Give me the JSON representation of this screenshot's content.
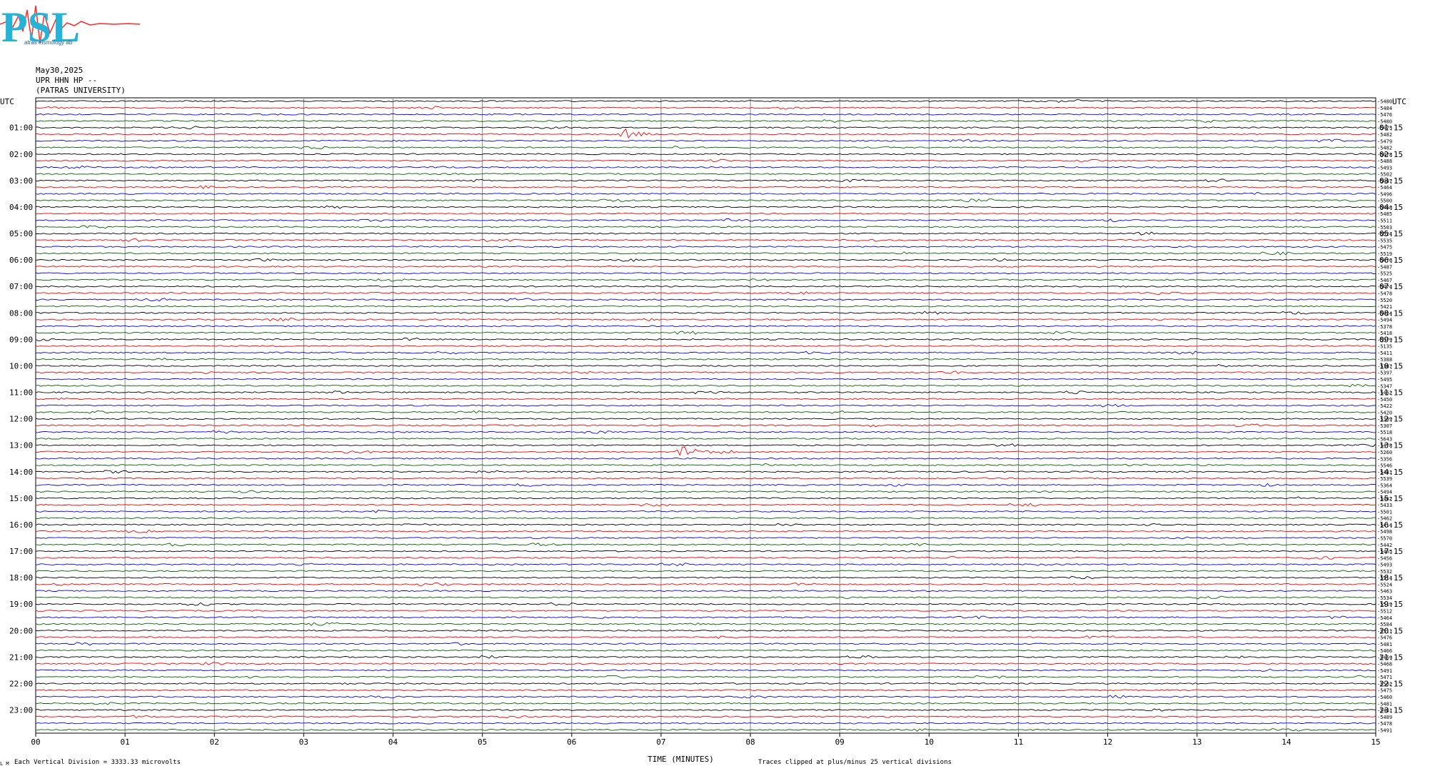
{
  "header": {
    "logo_text": "PSL",
    "logo_sub": "atras eismology ab",
    "date": "May30,2025",
    "channel": "UPR HHN HP --",
    "institution": "(PATRAS UNIVERSITY)"
  },
  "colors": {
    "black": "#000000",
    "red": "#ff0000",
    "blue": "#0000ff",
    "green": "#006400",
    "grid": "#888888"
  },
  "chart_data": {
    "type": "line",
    "title": "",
    "xlabel": "TIME (MINUTES)",
    "ylabel": "",
    "left_axis_title": "UTC",
    "right_axis_title": "UTC",
    "xlim": [
      0,
      15
    ],
    "x_ticks": [
      "00",
      "01",
      "02",
      "03",
      "04",
      "05",
      "06",
      "07",
      "08",
      "09",
      "10",
      "11",
      "12",
      "13",
      "14",
      "15"
    ],
    "left_hour_labels": [
      "01:00",
      "02:00",
      "03:00",
      "04:00",
      "05:00",
      "06:00",
      "07:00",
      "08:00",
      "09:00",
      "10:00",
      "11:00",
      "12:00",
      "13:00",
      "14:00",
      "15:00",
      "16:00",
      "17:00",
      "18:00",
      "19:00",
      "20:00",
      "21:00",
      "22:00",
      "23:00"
    ],
    "right_hour_labels": [
      "01:15",
      "02:15",
      "03:15",
      "04:15",
      "05:15",
      "06:15",
      "07:15",
      "08:15",
      "09:15",
      "10:15",
      "11:15",
      "12:15",
      "13:15",
      "14:15",
      "15:15",
      "16:15",
      "17:15",
      "18:15",
      "19:15",
      "20:15",
      "21:15",
      "22:15",
      "23:15"
    ],
    "trace_offsets": [
      "-5480",
      "-5484",
      "-5476",
      "-5480",
      "-5475",
      "-5482",
      "-5479",
      "-5482",
      "-5478",
      "-5488",
      "-5493",
      "-5502",
      "-5487",
      "-5464",
      "-5496",
      "-5500",
      "-5468",
      "-5485",
      "-5511",
      "-5503",
      "-5524",
      "-5535",
      "-5475",
      "-5519",
      "-5476",
      "-5487",
      "-5525",
      "-5467",
      "-5474",
      "-5478",
      "-5520",
      "-5421",
      "-5424",
      "-5494",
      "-5378",
      "-5418",
      "-5379",
      "-5135",
      "-5411",
      "-5388",
      "-5387",
      "-5397",
      "-5495",
      "-5347",
      "-5462",
      "-5450",
      "-5422",
      "-5420",
      "-5389",
      "-5307",
      "-5518",
      "-5643",
      "-5478",
      "-5260",
      "-5356",
      "-5546",
      "-5481",
      "-5539",
      "-5364",
      "-5494",
      "-5462",
      "-5433",
      "-5501",
      "-5462",
      "-5414",
      "-5498",
      "-5570",
      "-5442",
      "-5465",
      "-5456",
      "-5493",
      "-5532",
      "-5514",
      "-5524",
      "-5463",
      "-5534",
      "-5519",
      "-5512",
      "-5464",
      "-5584",
      "-5511",
      "-5476",
      "-5481",
      "-5466",
      "-5469",
      "-5468",
      "-5491",
      "-5471",
      "-5502",
      "-5475",
      "-5460",
      "-5481",
      "-5481",
      "-5489",
      "-5478",
      "-5491"
    ],
    "color_cycle": [
      "black",
      "red",
      "blue",
      "green"
    ],
    "events": [
      {
        "trace": 5,
        "minute": 6.6,
        "amplitude": 7
      },
      {
        "trace": 53,
        "minute": 7.25,
        "amplitude": 12
      }
    ],
    "grid": true
  },
  "footer": {
    "left_note": "Each Vertical Division = 3333.33 microvolts",
    "right_note": "Traces clipped at plus/minus 25 vertical divisions",
    "corner_mark": "L M"
  }
}
